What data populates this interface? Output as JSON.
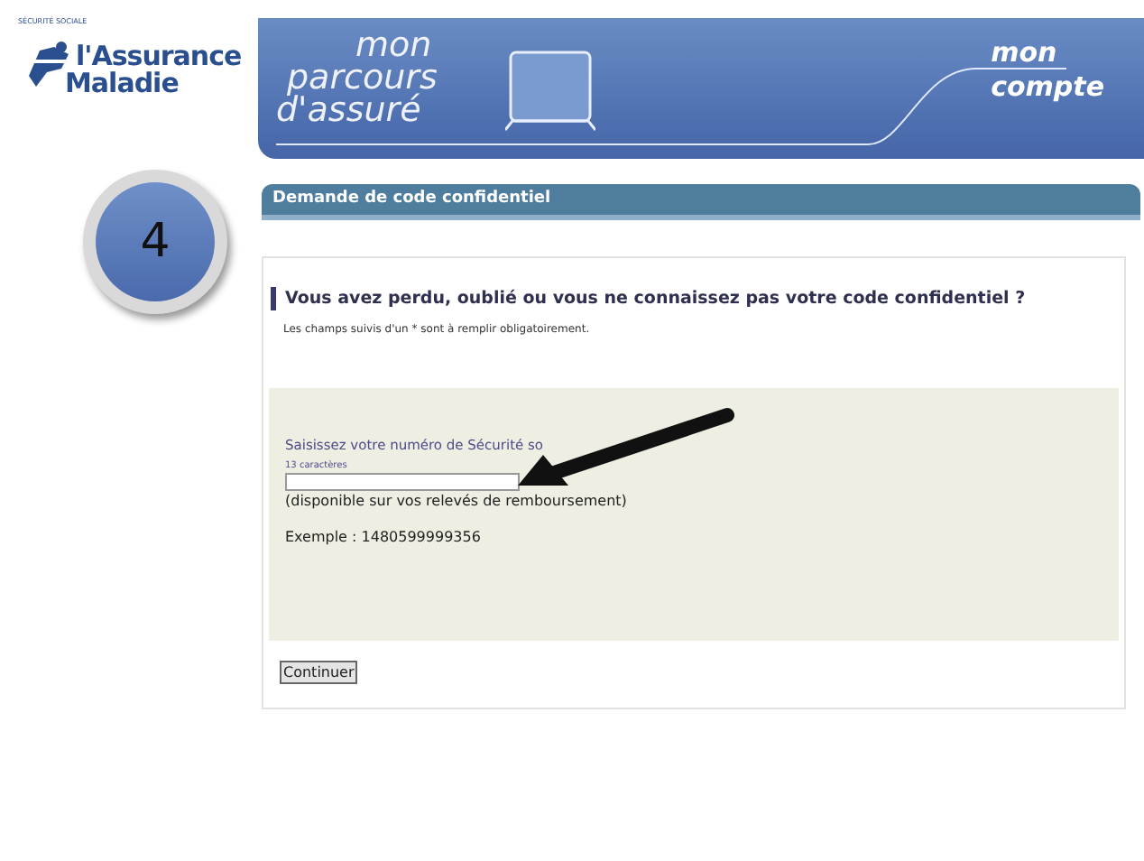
{
  "logo": {
    "arc_text": "SÉCURITÉ SOCIALE",
    "line_1": "l'Assurance",
    "line_2": "Maladie"
  },
  "banner": {
    "left_lines": [
      "mon",
      "parcours",
      "d'assuré"
    ],
    "right_lines": [
      "mon",
      "compte"
    ]
  },
  "step": {
    "number": "4"
  },
  "panel": {
    "title": "Demande de code confidentiel"
  },
  "form": {
    "heading": "Vous avez perdu, oublié ou vous ne connaissez pas votre code confidentiel ?",
    "note": "Les champs suivis d'un * sont à remplir obligatoirement.",
    "field": {
      "label": "Saisissez votre numéro de Sécurité so",
      "hint": "13 caractères",
      "help": "(disponible sur vos relevés de remboursement)",
      "example": "Exemple : 1480599999356"
    },
    "button": "Continuer"
  }
}
